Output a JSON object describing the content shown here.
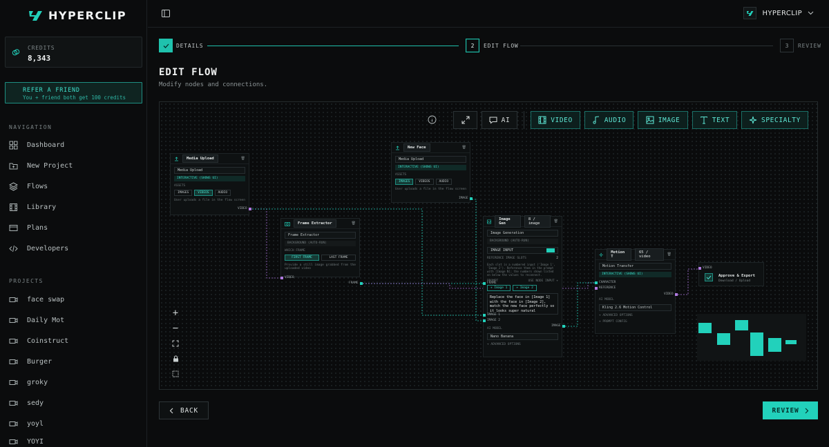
{
  "brand": {
    "name": "HYPERCLIP"
  },
  "credits": {
    "label": "CREDITS",
    "value": "8,343"
  },
  "refer": {
    "title": "REFER A FRIEND",
    "subtitle": "You + friend both get 100 credits"
  },
  "navigation": {
    "title": "NAVIGATION",
    "items": [
      {
        "label": "Dashboard",
        "icon": "grid-icon"
      },
      {
        "label": "New Project",
        "icon": "folder-plus-icon"
      },
      {
        "label": "Flows",
        "icon": "layers-icon"
      },
      {
        "label": "Library",
        "icon": "film-icon"
      },
      {
        "label": "Plans",
        "icon": "card-icon"
      },
      {
        "label": "Developers",
        "icon": "code-icon"
      }
    ]
  },
  "projects": {
    "title": "PROJECTS",
    "items": [
      {
        "label": "face swap"
      },
      {
        "label": "Daily Mot"
      },
      {
        "label": "Coinstruct"
      },
      {
        "label": "Burger"
      },
      {
        "label": "groky"
      },
      {
        "label": "sedy"
      },
      {
        "label": "yoyl"
      },
      {
        "label": "YOYI"
      }
    ]
  },
  "header": {
    "user_name": "HYPERCLIP"
  },
  "stepper": {
    "steps": [
      {
        "num": "1",
        "label": "DETAILS",
        "state": "done"
      },
      {
        "num": "2",
        "label": "EDIT FLOW",
        "state": "active"
      },
      {
        "num": "3",
        "label": "REVIEW",
        "state": "pending"
      }
    ]
  },
  "page": {
    "title": "EDIT FLOW",
    "subtitle": "Modify nodes and connections."
  },
  "toolbar": {
    "ai_label": "AI",
    "categories": [
      {
        "label": "VIDEO",
        "icon": "film-icon"
      },
      {
        "label": "AUDIO",
        "icon": "music-note-icon"
      },
      {
        "label": "IMAGE",
        "icon": "image-icon"
      },
      {
        "label": "TEXT",
        "icon": "text-icon"
      },
      {
        "label": "SPECIALTY",
        "icon": "sparkle-icon"
      }
    ]
  },
  "nodes": {
    "media_upload": {
      "title": "Media Upload",
      "select": "Media Upload",
      "badge": "INTERACTIVE (SHOWS UI)",
      "section": "ASSETS",
      "chips": [
        "IMAGES",
        "VIDEOS",
        "AUDIO"
      ],
      "hint": "User uploads a file in the flow screen",
      "port_out": "VIDEO"
    },
    "new_face": {
      "title": "New Face",
      "select": "Media Upload",
      "badge": "INTERACTIVE (SHOWS UI)",
      "section": "ASSETS",
      "chips": [
        "IMAGES",
        "VIDEOS",
        "AUDIO"
      ],
      "hint": "User uploads a file in the flow screen",
      "port_out": "IMAGE"
    },
    "frame_extractor": {
      "title": "Frame Extractor",
      "select": "Frame Extractor",
      "badge": "BACKGROUND (AUTO-RUN)",
      "section": "WHICH FRAME",
      "chips": [
        "FIRST FRAME",
        "LAST FRAME"
      ],
      "hint": "Provide a still image grabbed from the uploaded video",
      "port_in": "VIDEO",
      "port_out": "FRAME"
    },
    "image_gen": {
      "title": "Image Gen",
      "cost": "8 / image",
      "select": "Image Generation",
      "badge": "BACKGROUND (AUTO-RUN)",
      "toggle_label": "IMAGE INPUT",
      "refs_label": "REFERENCE IMAGE SLOTS",
      "refs_count": "2",
      "refs_hint": "Each slot is a numbered input ('Image 1', 'Image 2'). Reference them in the prompt with [Image N]; the numbers shown listed on below the values to reconnect.",
      "prompt_label": "PROMPT",
      "prompt_right": "USE NODE INPUT +",
      "chips": [
        "+ Image 1",
        "+ Image 2"
      ],
      "prompt_text": "Replace the face in [Image 1] with the face in [Image 2], match the new face perfectly so it looks super natural",
      "ports_in": [
        "FRAME",
        "IMAGE 1",
        "IMAGE 2"
      ],
      "model_label": "AI MODEL",
      "model": "Nano Banana",
      "advanced": "+ ADVANCED OPTIONS",
      "port_out": "IMAGE"
    },
    "motion": {
      "title": "Motion T",
      "cost": "65 / video",
      "select": "Motion Transfer",
      "badge": "INTERACTIVE (SHOWS UI)",
      "ports_in": [
        "CHARACTER",
        "REFERENCE"
      ],
      "model_label": "AI MODEL",
      "model": "Kling 2.6 Motion Control",
      "advanced": "+ ADVANCED OPTIONS",
      "prompt": "+ PROMPT CONFIG",
      "port_out": "VIDEO"
    },
    "approve": {
      "title": "Approve & Export",
      "subtitle": "Download / Upload",
      "port_in": "VIDEO"
    }
  },
  "footer": {
    "back_label": "BACK",
    "review_label": "REVIEW"
  }
}
